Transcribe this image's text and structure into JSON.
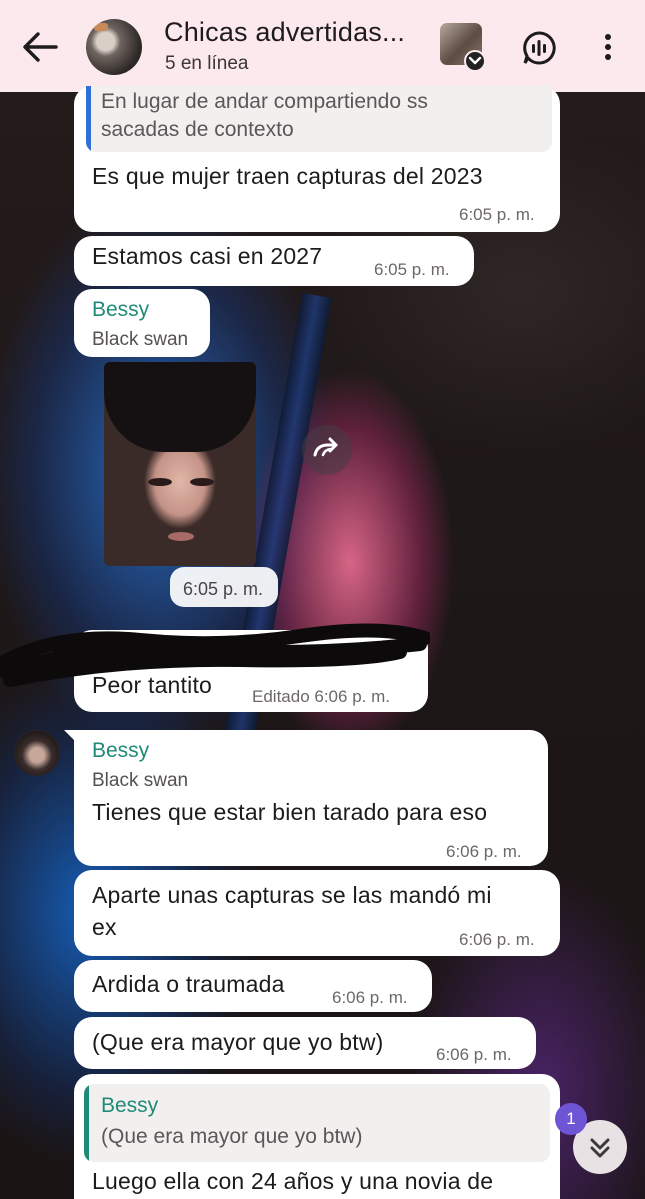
{
  "header": {
    "title": "Chicas advertidas...",
    "subtitle": "5 en línea",
    "mini_badge_icon": "chevron-down-icon"
  },
  "messages": [
    {
      "quote": "En lugar de andar compartiendo ss\nsacadas de contexto",
      "text": "Es que mujer traen capturas del 2023",
      "time": "6:05 p. m."
    },
    {
      "text": "Estamos casi en 2027",
      "time": "6:05 p. m."
    },
    {
      "sender": "Bessy",
      "sender_sub": "Black swan",
      "photo_time": "6:05 p. m."
    },
    {
      "text": "Peor tantito",
      "time": "Editado 6:06 p. m."
    },
    {
      "sender": "Bessy",
      "sender_sub": "Black swan",
      "text": "Tienes que estar bien tarado para eso",
      "time": "6:06 p. m."
    },
    {
      "text_line1": "Aparte unas capturas se las mandó mi",
      "text_line2": "ex",
      "time": "6:06 p. m."
    },
    {
      "text": "Ardida o traumada",
      "time": "6:06 p. m."
    },
    {
      "text": "(Que era mayor que yo btw)",
      "time": "6:06 p. m."
    },
    {
      "quote_sender": "Bessy",
      "quote": "(Que era mayor que yo btw)",
      "text": "Luego ella con 24 años y una novia de"
    }
  ],
  "unread_count": "1",
  "colors": {
    "header_bg": "#fbe9ee",
    "sender_name": "#1f8a78",
    "quote_bar_blue": "#2f6fd6",
    "quote_bar_green": "#1f8a78",
    "unread_badge": "#6d55d6"
  }
}
